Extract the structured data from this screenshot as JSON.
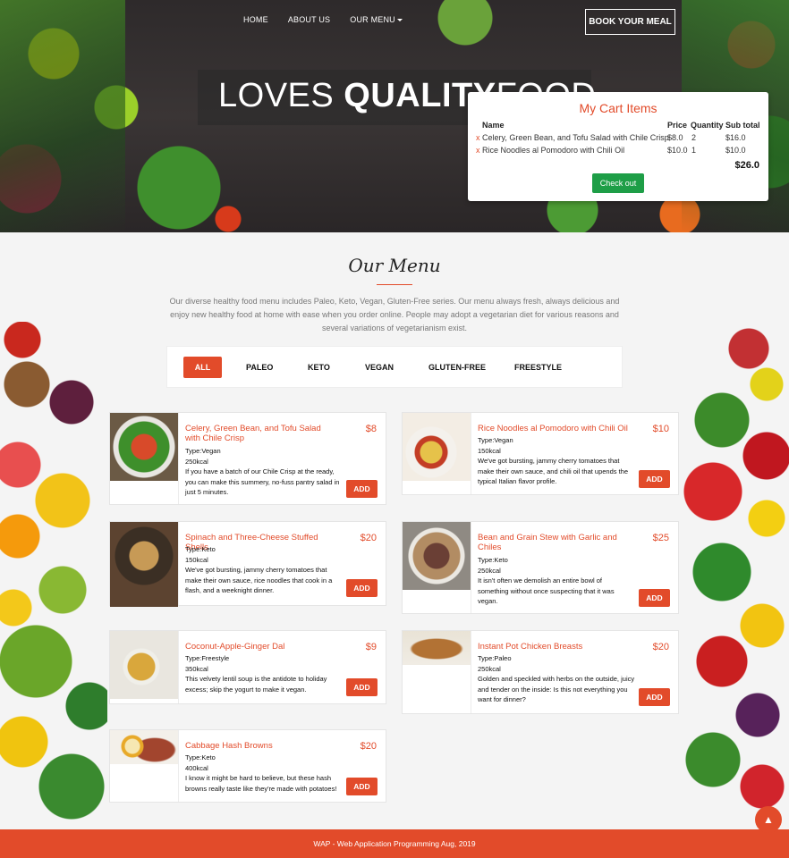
{
  "nav": {
    "items": [
      "HOME",
      "ABOUT US",
      "OUR MENU"
    ],
    "book_label": "BOOK YOUR MEAL"
  },
  "hero": {
    "title_light": "LOVES ",
    "title_bold": "QUALITY",
    "title_tail": "FOOD"
  },
  "cart": {
    "title": "My Cart Items",
    "headers": [
      "Name",
      "Price",
      "Quantity",
      "Sub total"
    ],
    "rows": [
      {
        "remove": "x",
        "name": "Celery, Green Bean, and Tofu Salad with Chile Crisp",
        "price": "$8.0",
        "qty": "2",
        "subtotal": "$16.0"
      },
      {
        "remove": "x",
        "name": "Rice Noodles al Pomodoro with Chili Oil",
        "price": "$10.0",
        "qty": "1",
        "subtotal": "$10.0"
      }
    ],
    "total": "$26.0",
    "checkout_label": "Check out"
  },
  "menu": {
    "title": "Our Menu",
    "description": "Our diverse healthy food menu includes Paleo, Keto, Vegan, Gluten-Free series. Our menu always fresh, always delicious and enjoy new healthy food at home with ease when you order online. People may adopt a vegetarian diet for various reasons and several variations of vegetarianism exist.",
    "filters": [
      "ALL",
      "PALEO",
      "KETO",
      "VEGAN",
      "GLUTEN-FREE",
      "FREESTYLE"
    ],
    "add_label": "ADD",
    "items": [
      {
        "title": "Celery, Green Bean, and Tofu Salad with Chile Crisp",
        "price": "$8",
        "type": "Type:Vegan",
        "kcal": "250kcal",
        "desc": "If you have a batch of our Chile Crisp at the ready, you can make this summery, no-fuss pantry salad in just 5 minutes."
      },
      {
        "title": "Rice Noodles al Pomodoro with Chili Oil",
        "price": "$10",
        "type": "Type:Vegan",
        "kcal": "150kcal",
        "desc": "We've got bursting, jammy cherry tomatoes that make their own sauce, and chili oil that upends the typical Italian flavor profile."
      },
      {
        "title": "Spinach and Three-Cheese Stuffed Shells",
        "price": "$20",
        "type": "Type:Keto",
        "kcal": "150kcal",
        "desc": "We've got bursting, jammy cherry tomatoes that make their own sauce, rice noodles that cook in a flash, and a weeknight dinner."
      },
      {
        "title": "Bean and Grain Stew with Garlic and Chiles",
        "price": "$25",
        "type": "Type:Keto",
        "kcal": "250kcal",
        "desc": "It isn't often we demolish an entire bowl of something without once suspecting that it was vegan."
      },
      {
        "title": "Coconut-Apple-Ginger Dal",
        "price": "$9",
        "type": "Type:Freestyle",
        "kcal": "350kcal",
        "desc": "This velvety lentil soup is the antidote to holiday excess; skip the yogurt to make it vegan."
      },
      {
        "title": "Instant Pot Chicken Breasts",
        "price": "$20",
        "type": "Type:Paleo",
        "kcal": "250kcal",
        "desc": "Golden and speckled with herbs on the outside, juicy and tender on the inside: Is this not everything you want for dinner?"
      },
      {
        "title": "Cabbage Hash Browns",
        "price": "$20",
        "type": "Type:Keto",
        "kcal": "400kcal",
        "desc": "I know it might be hard to believe, but these hash browns really taste like they're made with potatoes!"
      }
    ]
  },
  "footer": {
    "text": "WAP - Web Application Programming Aug, 2019"
  },
  "colors": {
    "accent": "#e24b2a",
    "checkout": "#1e9e47"
  }
}
